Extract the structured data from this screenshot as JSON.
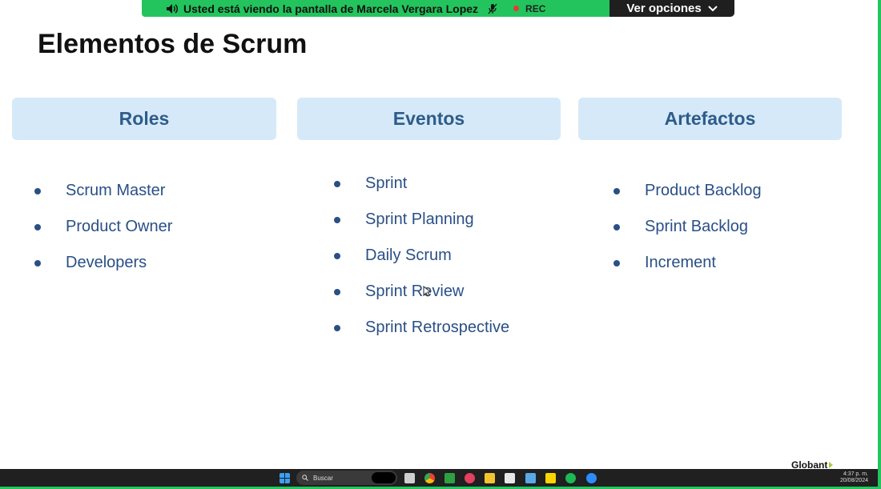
{
  "share_banner": {
    "message": "Usted está viendo la pantalla de  Marcela Vergara Lopez",
    "rec_label": "REC",
    "view_options_label": "Ver opciones"
  },
  "slide": {
    "title": "Elementos de Scrum",
    "columns": [
      {
        "header": "Roles",
        "items": [
          "Scrum Master",
          "Product Owner",
          "Developers"
        ]
      },
      {
        "header": "Eventos",
        "items": [
          "Sprint",
          "Sprint Planning",
          "Daily Scrum",
          "Sprint Review",
          "Sprint Retrospective"
        ]
      },
      {
        "header": "Artefactos",
        "items": [
          "Product Backlog",
          "Sprint Backlog",
          "Increment"
        ]
      }
    ],
    "logo_text": "Globant"
  },
  "taskbar": {
    "search_placeholder": "Buscar",
    "time": "4:37 p. m.",
    "date": "20/08/2024",
    "icons": [
      "windows-start-icon",
      "task-view-icon",
      "chrome-icon",
      "chat-icon",
      "app-icon",
      "file-explorer-icon",
      "editor-icon",
      "notepad-icon",
      "sticky-notes-icon",
      "spotify-icon",
      "zoom-icon"
    ]
  },
  "colors": {
    "share_green": "#23c45d",
    "header_bg": "#d6e9f8",
    "header_text": "#2e5c8a",
    "item_text": "#2a4f86"
  }
}
